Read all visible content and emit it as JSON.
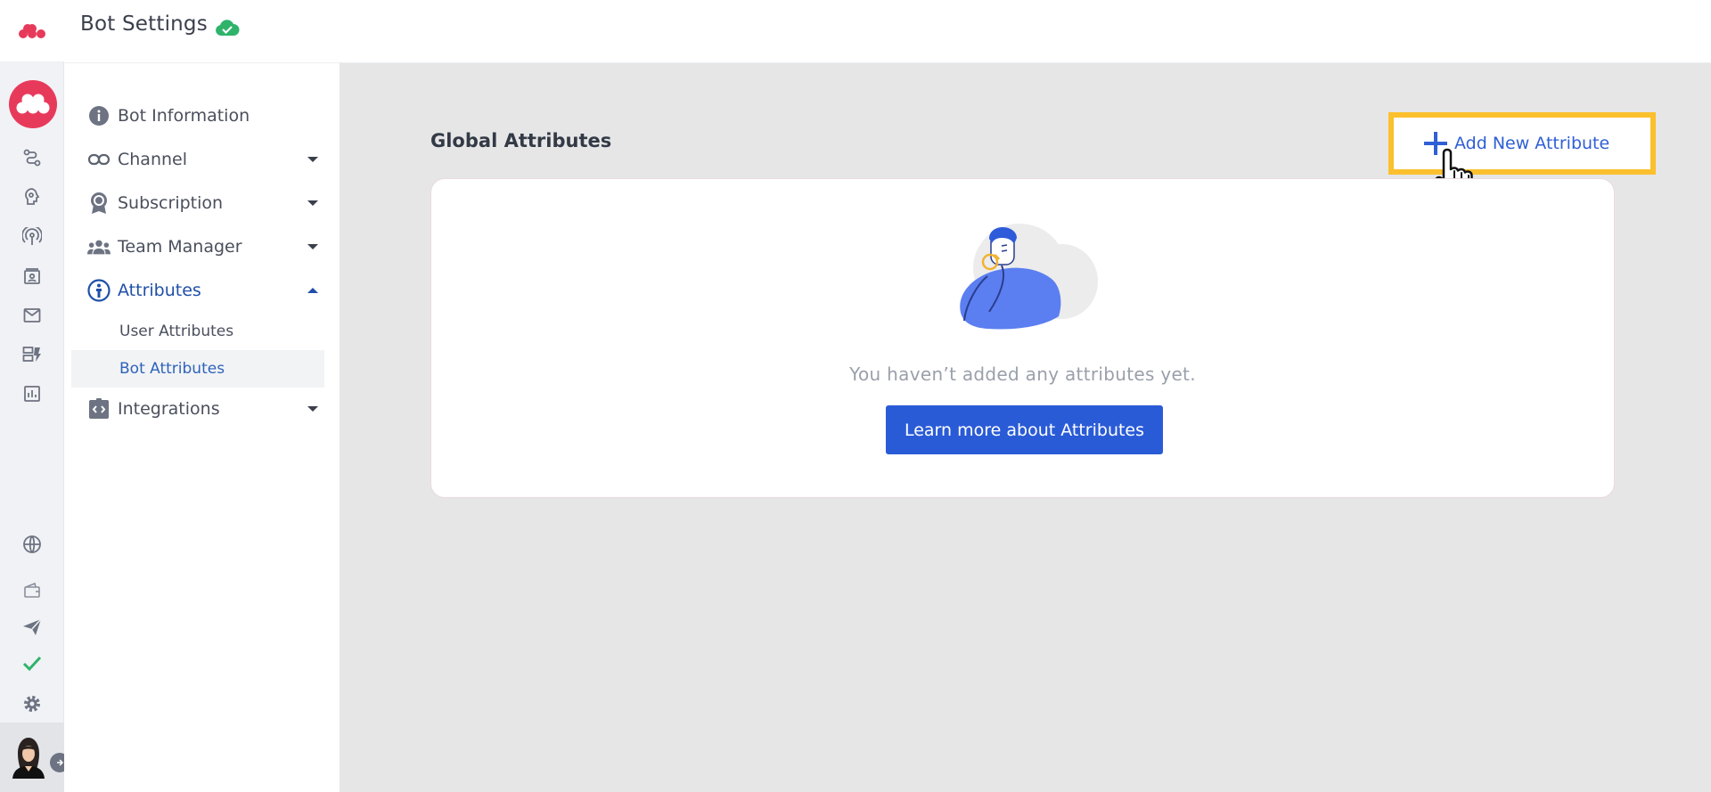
{
  "header": {
    "title": "Bot Settings",
    "status_icon": "cloud-check-icon",
    "status_color": "#2fb36b"
  },
  "rail": {
    "brand_color": "#e73a5b",
    "icons": [
      "bot-flow-icon",
      "brain-icon",
      "broadcast-icon",
      "contacts-icon",
      "mail-icon",
      "templates-icon",
      "analytics-icon",
      "globe-icon",
      "wallet-icon",
      "send-icon",
      "check-icon",
      "gear-icon"
    ]
  },
  "nav": {
    "items": [
      {
        "label": "Bot Information",
        "icon": "info-icon"
      },
      {
        "label": "Channel",
        "icon": "link-icon"
      },
      {
        "label": "Subscription",
        "icon": "badge-icon"
      },
      {
        "label": "Team Manager",
        "icon": "team-icon"
      },
      {
        "label": "Attributes",
        "icon": "attribute-icon"
      },
      {
        "label": "Integrations",
        "icon": "integrations-icon"
      }
    ],
    "sub_items": [
      {
        "label": "User Attributes"
      },
      {
        "label": "Bot Attributes"
      }
    ],
    "active_color": "#1f4fa8"
  },
  "main": {
    "section_title": "Global Attributes",
    "add_button_label": "Add New Attribute",
    "empty_message": "You haven’t added any attributes yet.",
    "learn_button_label": "Learn more about Attributes",
    "accent_color": "#2a5bd7",
    "highlight_color": "#fbc02d"
  }
}
